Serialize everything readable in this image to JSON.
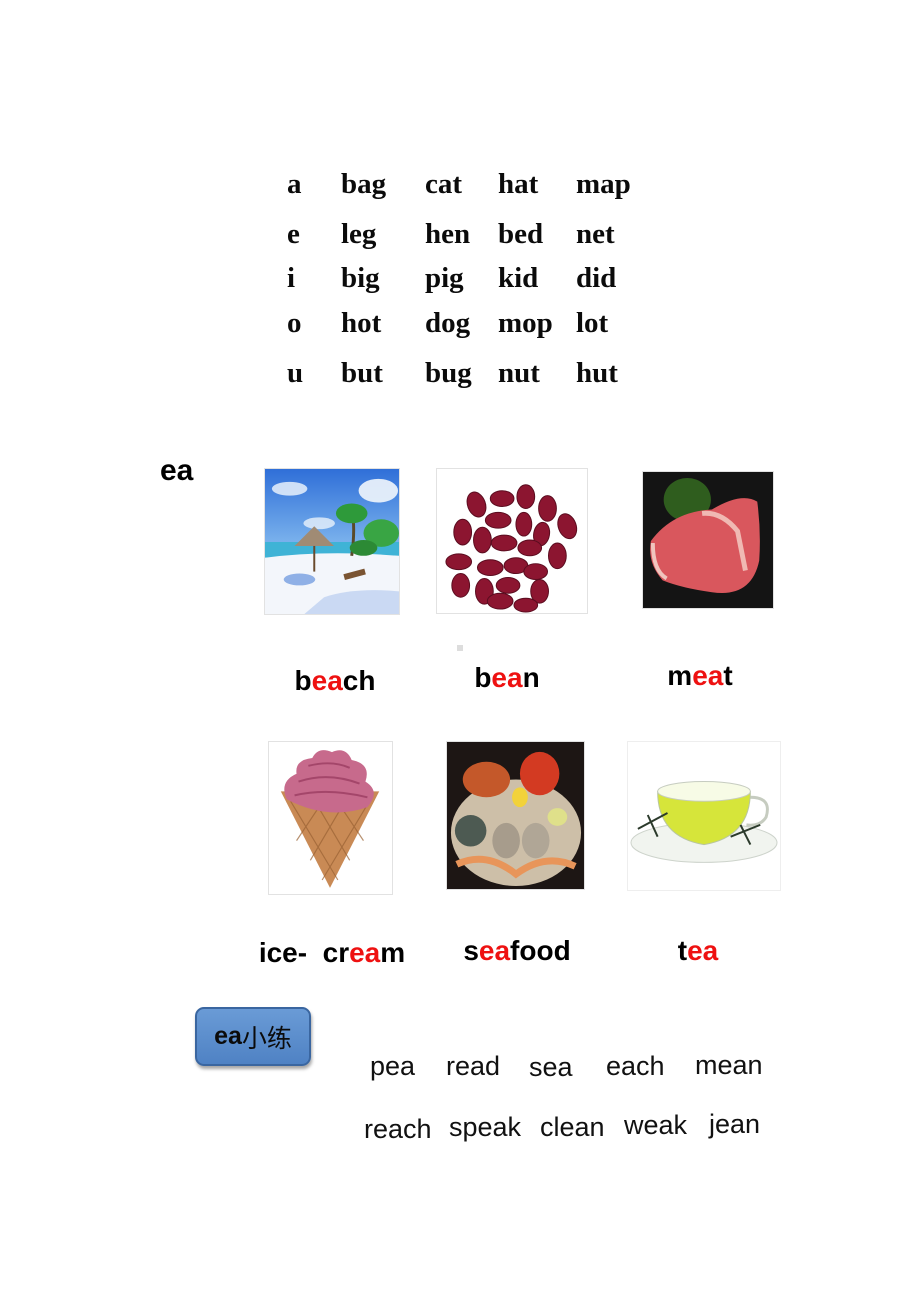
{
  "vowel_table": {
    "rows": [
      {
        "vowel": "a",
        "words": [
          "bag",
          "cat",
          "hat",
          "map"
        ]
      },
      {
        "vowel": "e",
        "words": [
          "leg",
          "hen",
          "bed",
          "net"
        ]
      },
      {
        "vowel": "i",
        "words": [
          "big",
          "pig",
          "kid",
          "did"
        ]
      },
      {
        "vowel": "o",
        "words": [
          "hot",
          "dog",
          "mop",
          "lot"
        ]
      },
      {
        "vowel": "u",
        "words": [
          "but",
          "bug",
          "nut",
          "hut"
        ]
      }
    ]
  },
  "section_title": "ea",
  "highlight_color": "#ee1111",
  "vocab": [
    {
      "image": "beach-picture",
      "parts": [
        "b",
        "ea",
        "ch"
      ]
    },
    {
      "image": "bean-picture",
      "parts": [
        "b",
        "ea",
        "n"
      ]
    },
    {
      "image": "meat-picture",
      "parts": [
        "m",
        "ea",
        "t"
      ]
    },
    {
      "image": "ice-cream-picture",
      "parts": [
        "ice-  cr",
        "ea",
        "m"
      ]
    },
    {
      "image": "seafood-picture",
      "parts": [
        "s",
        "ea",
        "food"
      ]
    },
    {
      "image": "tea-picture",
      "parts": [
        "t",
        "ea",
        ""
      ]
    }
  ],
  "practice": {
    "button_prefix": "ea",
    "button_suffix": "小练",
    "button_color": "#5b8ccc",
    "rows": [
      [
        "pea",
        "read",
        "sea",
        "each",
        "mean"
      ],
      [
        "reach",
        "speak",
        "clean",
        "weak",
        "jean"
      ]
    ]
  }
}
